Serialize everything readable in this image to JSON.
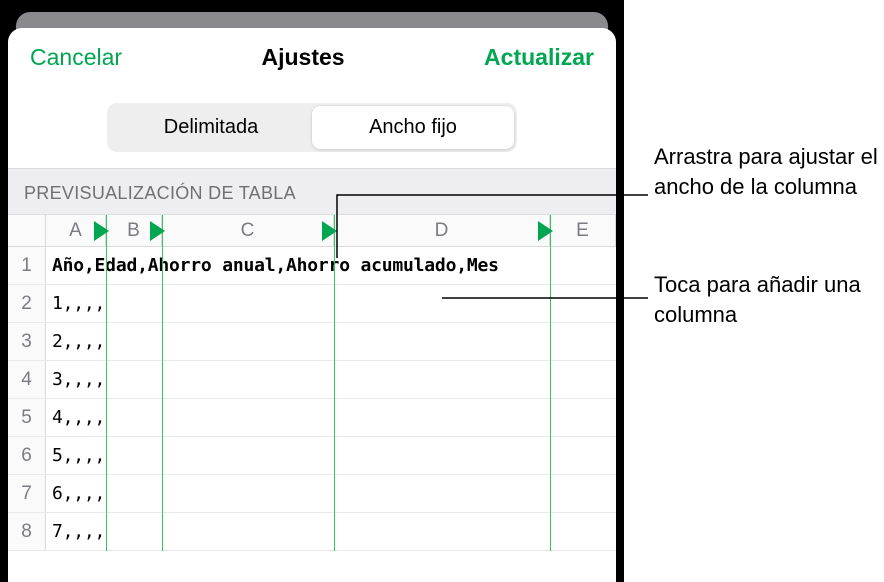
{
  "header": {
    "cancel": "Cancelar",
    "title": "Ajustes",
    "update": "Actualizar"
  },
  "segmented": {
    "delimited": "Delimitada",
    "fixed_width": "Ancho fijo"
  },
  "section": {
    "preview_label": "PREVISUALIZACIÓN DE TABLA"
  },
  "columns": [
    "A",
    "B",
    "C",
    "D",
    "E"
  ],
  "rows": [
    {
      "num": "1",
      "text": "Año,Edad,Ahorro anual,Ahorro acumulado,Mes"
    },
    {
      "num": "2",
      "text": "1,,,,"
    },
    {
      "num": "3",
      "text": "2,,,,"
    },
    {
      "num": "4",
      "text": "3,,,,"
    },
    {
      "num": "5",
      "text": "4,,,,"
    },
    {
      "num": "6",
      "text": "5,,,,"
    },
    {
      "num": "7",
      "text": "6,,,,"
    },
    {
      "num": "8",
      "text": "7,,,,"
    }
  ],
  "annotations": {
    "drag_resize": "Arrastra para ajustar el ancho de la columna",
    "tap_add": "Toca para añadir una columna"
  }
}
